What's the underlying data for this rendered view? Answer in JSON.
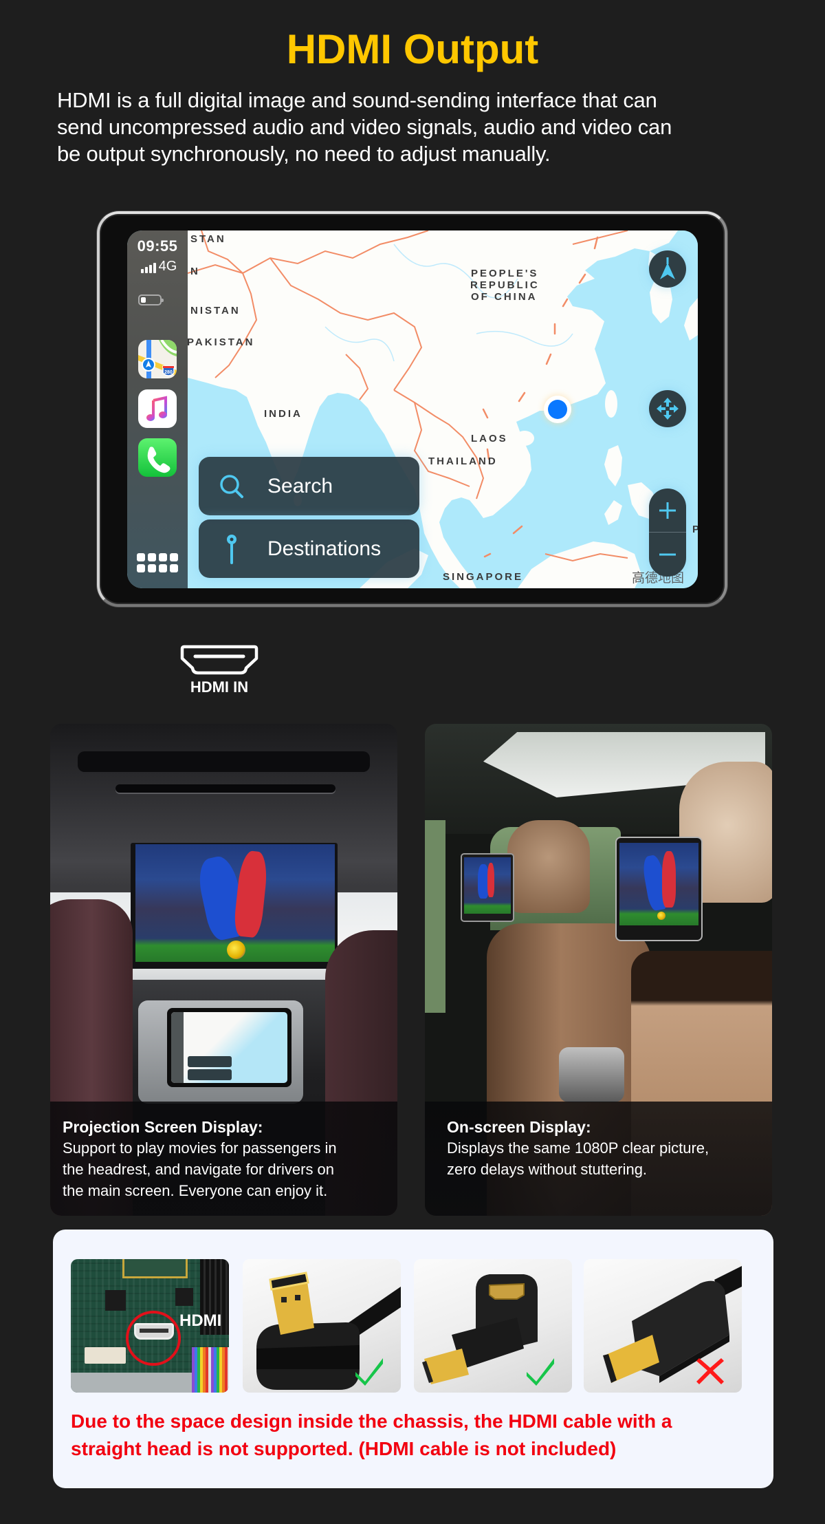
{
  "header": {
    "title": "HDMI Output",
    "description_lines": [
      "HDMI is a full digital image and sound-sending interface that can",
      "send uncompressed audio and video signals, audio and video can",
      "be output synchronously, no need to adjust manually."
    ]
  },
  "colors": {
    "title": "#ffc700",
    "background": "#1e1e1e",
    "notice": "#f20010",
    "supported": "#17c54a",
    "not_supported": "#ff1a1a",
    "carplay_accent": "#4fc8f0"
  },
  "device": {
    "status_bar": {
      "time": "09:55",
      "network": "4G",
      "signal_bars": 4,
      "battery_fraction": 0.25
    },
    "dock_apps": [
      {
        "name": "Maps",
        "icon": "maps-app-icon",
        "badge": "280"
      },
      {
        "name": "Music",
        "icon": "music-app-icon"
      },
      {
        "name": "Phone",
        "icon": "phone-app-icon"
      }
    ],
    "map": {
      "labels": {
        "stan": "STAN",
        "n": "N",
        "nistan": "NISTAN",
        "pakistan": "PAKISTAN",
        "india": "INDIA",
        "china_1": "PEOPLE'S",
        "china_2": "REPUBLIC",
        "china_3": "OF CHINA",
        "laos": "LAOS",
        "thailand": "THAILAND",
        "singapore": "SINGAPORE",
        "p": "P"
      },
      "watermark": "高德地图",
      "search_label": "Search",
      "destinations_label": "Destinations",
      "controls": [
        "compass",
        "pan",
        "zoom-in",
        "zoom-out"
      ]
    }
  },
  "connector": {
    "label": "HDMI IN",
    "icon": "hdmi-port-icon"
  },
  "features": [
    {
      "title": "Projection Screen Display:",
      "lines": [
        "Support to play movies for passengers in",
        "the headrest, and navigate for drivers on",
        "the main screen. Everyone can enjoy it."
      ]
    },
    {
      "title": "On-screen Display:",
      "lines": [
        "Displays the same 1080P clear picture,",
        "zero delays without stuttering."
      ]
    }
  ],
  "compatibility": {
    "tiles": [
      {
        "subject": "HDMI port on board",
        "label": "HDMI",
        "status": "none"
      },
      {
        "subject": "Right-angle HDMI cable",
        "status": "supported"
      },
      {
        "subject": "Right-angle HDMI adapter",
        "status": "supported"
      },
      {
        "subject": "Straight HDMI cable",
        "status": "not-supported"
      }
    ],
    "notice_lines": [
      "Due to the space design inside the chassis, the HDMI cable with a",
      "straight head is not supported. (HDMI cable is not included)"
    ]
  }
}
